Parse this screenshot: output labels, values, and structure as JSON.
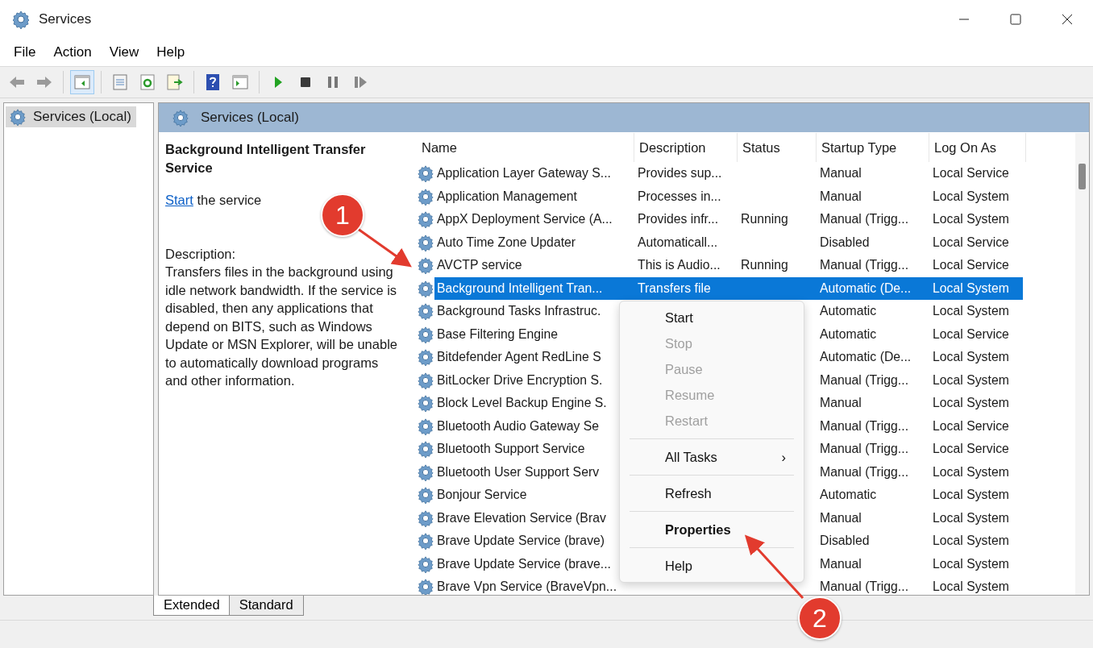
{
  "window": {
    "title": "Services"
  },
  "menu": [
    "File",
    "Action",
    "View",
    "Help"
  ],
  "tree": {
    "items": [
      {
        "label": "Services (Local)",
        "selected": true
      }
    ]
  },
  "panel": {
    "title": "Services (Local)"
  },
  "details": {
    "title": "Background Intelligent Transfer Service",
    "start_link": "Start",
    "start_suffix": " the service",
    "description_label": "Description:",
    "description": "Transfers files in the background using idle network bandwidth. If the service is disabled, then any applications that depend on BITS, such as Windows Update or MSN Explorer, will be unable to automatically download programs and other information."
  },
  "table": {
    "columns": [
      "Name",
      "Description",
      "Status",
      "Startup Type",
      "Log On As"
    ],
    "rows": [
      {
        "name": "Application Layer Gateway S...",
        "description": "Provides sup...",
        "startup": "Manual",
        "logon": "Local Service",
        "selected": false
      },
      {
        "name": "Application Management",
        "description": "Processes in...",
        "startup": "Manual",
        "logon": "Local System",
        "selected": false
      },
      {
        "name": "AppX Deployment Service (A...",
        "description": "Provides infr...",
        "status": "Running",
        "startup": "Manual (Trigg...",
        "logon": "Local System",
        "selected": false
      },
      {
        "name": "Auto Time Zone Updater",
        "description": "Automaticall...",
        "startup": "Disabled",
        "logon": "Local Service",
        "selected": false
      },
      {
        "name": "AVCTP service",
        "description": "This is Audio...",
        "status": "Running",
        "startup": "Manual (Trigg...",
        "logon": "Local Service",
        "selected": false
      },
      {
        "name": "Background Intelligent Tran...",
        "description": "Transfers file",
        "startup": "Automatic (De...",
        "logon": "Local System",
        "selected": true
      },
      {
        "name": "Background Tasks Infrastruc.",
        "startup": "Automatic",
        "logon": "Local System",
        "selected": false
      },
      {
        "name": "Base Filtering Engine",
        "startup": "Automatic",
        "logon": "Local Service",
        "selected": false
      },
      {
        "name": "Bitdefender Agent RedLine S",
        "startup": "Automatic (De...",
        "logon": "Local System",
        "selected": false
      },
      {
        "name": "BitLocker Drive Encryption S.",
        "startup": "Manual (Trigg...",
        "logon": "Local System",
        "selected": false
      },
      {
        "name": "Block Level Backup Engine S.",
        "startup": "Manual",
        "logon": "Local System",
        "selected": false
      },
      {
        "name": "Bluetooth Audio Gateway Se",
        "startup": "Manual (Trigg...",
        "logon": "Local Service",
        "selected": false
      },
      {
        "name": "Bluetooth Support Service",
        "startup": "Manual (Trigg...",
        "logon": "Local Service",
        "selected": false
      },
      {
        "name": "Bluetooth User Support Serv",
        "startup": "Manual (Trigg...",
        "logon": "Local System",
        "selected": false
      },
      {
        "name": "Bonjour Service",
        "startup": "Automatic",
        "logon": "Local System",
        "selected": false
      },
      {
        "name": "Brave Elevation Service (Brav",
        "startup": "Manual",
        "logon": "Local System",
        "selected": false
      },
      {
        "name": "Brave Update Service (brave)",
        "startup": "Disabled",
        "logon": "Local System",
        "selected": false
      },
      {
        "name": "Brave Update Service (brave...",
        "startup": "Manual",
        "logon": "Local System",
        "selected": false
      },
      {
        "name": "Brave Vpn Service (BraveVpn...",
        "startup": "Manual (Trigg...",
        "logon": "Local System",
        "selected": false
      }
    ]
  },
  "context_menu": [
    {
      "kind": "item",
      "label": "Start",
      "disabled": false
    },
    {
      "kind": "item",
      "label": "Stop",
      "disabled": true
    },
    {
      "kind": "item",
      "label": "Pause",
      "disabled": true
    },
    {
      "kind": "item",
      "label": "Resume",
      "disabled": true
    },
    {
      "kind": "item",
      "label": "Restart",
      "disabled": true
    },
    {
      "kind": "separator"
    },
    {
      "kind": "submenu",
      "label": "All Tasks",
      "arrow": "›",
      "disabled": false
    },
    {
      "kind": "separator"
    },
    {
      "kind": "item",
      "label": "Refresh",
      "disabled": false
    },
    {
      "kind": "separator"
    },
    {
      "kind": "default",
      "label": "Properties",
      "disabled": false
    },
    {
      "kind": "separator"
    },
    {
      "kind": "item",
      "label": "Help",
      "disabled": false
    }
  ],
  "view_tabs": [
    {
      "label": "Extended",
      "selected": true
    },
    {
      "label": "Standard",
      "selected": false
    }
  ],
  "callouts": [
    {
      "label": "1"
    },
    {
      "label": "2"
    }
  ]
}
